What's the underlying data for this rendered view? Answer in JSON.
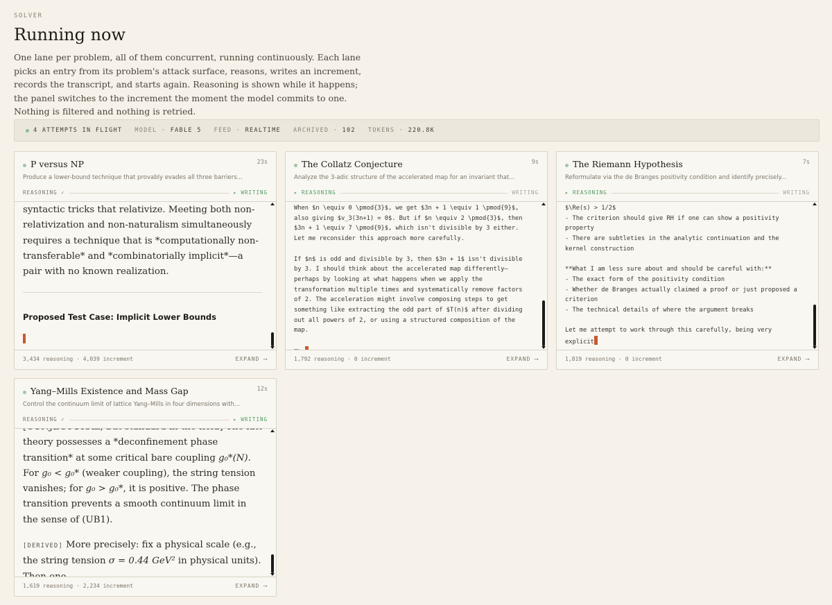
{
  "header": {
    "eyebrow": "SOLVER",
    "title": "Running now",
    "description": "One lane per problem, all of them concurrent, running continuously. Each lane picks an entry from its problem's attack surface, reasons, writes an increment, records the transcript, and starts again. Reasoning is shown while it happens; the panel switches to the increment the moment the model commits to one. Nothing is filtered and nothing is retried."
  },
  "status": {
    "attempts": "4 ATTEMPTS IN FLIGHT",
    "model_label": "MODEL",
    "model_value": "FABLE 5",
    "feed_label": "FEED",
    "feed_value": "REALTIME",
    "archived_label": "ARCHIVED",
    "archived_value": "102",
    "tokens_label": "TOKENS",
    "tokens_value": "220.8K",
    "sep": "·",
    "dot_color": "#8dbb97"
  },
  "colors": {
    "background": "#f6f2ea",
    "accent_cursor": "#c65a2e",
    "active_phase": "#4f9a62"
  },
  "lanes": [
    {
      "title": "P versus NP",
      "time": "23s",
      "subtitle": "Produce a lower-bound technique that provably evades all three barriers...",
      "phase_left": "REASONING ✓",
      "phase_right": "▸ WRITING",
      "body_p1": "syntactic tricks that relativize. Meeting both non-relativization and non-naturalism simultaneously requires a technique that is *computationally non-transferable* and *combinatorially implicit*—a pair with no known realization.",
      "body_heading": "Proposed Test Case: Implicit Lower Bounds",
      "reasoning_count": "3,434 reasoning",
      "increment_count": "4,039 increment",
      "expand": "EXPAND ⟶"
    },
    {
      "title": "The Collatz Conjecture",
      "time": "9s",
      "subtitle": "Analyze the 3-adic structure of the accelerated map for an invariant that...",
      "phase_left": "▸ REASONING",
      "phase_right": "WRITING",
      "body": "When $n \\equiv 0 \\pmod{3}$, we get $3n + 1 \\equiv 1 \\pmod{9}$, also giving $v_3(3n+1) = 0$. But if $n \\equiv 2 \\pmod{3}$, then $3n + 1 \\equiv 7 \\pmod{9}$, which isn't divisible by 3 either. Let me reconsider this approach more carefully.\n\nIf $n$ is odd and divisible by 3, then $3n + 1$ isn't divisible by 3. I should think about the accelerated map differently—perhaps by looking at what happens when we apply the transformation multiple times and systematically remove factors of 2. The acceleration might involve composing steps to get something like extracting the odd part of $T(n)$ after dividing out all powers of 2, or using a structured composition of the map.\n\nThe",
      "reasoning_count": "1,792 reasoning",
      "increment_count": "0 increment",
      "expand": "EXPAND ⟶"
    },
    {
      "title": "The Riemann Hypothesis",
      "time": "7s",
      "subtitle": "Reformulate via the de Branges positivity condition and identify precisely...",
      "phase_left": "▸ REASONING",
      "phase_right": "WRITING",
      "body": "$\\Re(s) > 1/2$\n- The criterion should give RH if one can show a positivity property\n- There are subtleties in the analytic continuation and the kernel construction\n\n**What I am less sure about and should be careful with:**\n- The exact form of the positivity condition\n- Whether de Branges actually claimed a proof or just proposed a criterion\n- The technical details of where the argument breaks\n\nLet me attempt to work through this carefully, being very explicit",
      "reasoning_count": "1,819 reasoning",
      "increment_count": "0 increment",
      "expand": "EXPAND ⟶"
    },
    {
      "title": "Yang–Mills Existence and Mass Gap",
      "time": "12s",
      "subtitle": "Control the continuum limit of lattice Yang–Mills in four dimensions with...",
      "phase_left": "REASONING ✓",
      "phase_right": "▸ WRITING",
      "body_clipped": "[CONJECTURAL, but standard in the field] The lattice",
      "body_p1a": "theory possesses a *deconfinement phase transition* at some critical bare coupling ",
      "math_gcrit": "g₀*(N)",
      "body_p1b": ". For ",
      "math_lt": "g₀ < g₀*",
      "body_p1c": " (weaker coupling), the string tension vanishes; for ",
      "math_gt": "g₀ > g₀*",
      "body_p1d": ", it is positive. The phase transition prevents a smooth continuum limit in the sense of (UB1).",
      "tag": "[DERIVED]",
      "body_p2a": " More precisely: fix a physical scale (e.g., the string tension ",
      "math_sigma": "σ = 0.44 GeV²",
      "body_p2b": " in physical units). Then one",
      "reasoning_count": "1,619 reasoning",
      "increment_count": "2,234 increment",
      "expand": "EXPAND ⟶"
    }
  ]
}
